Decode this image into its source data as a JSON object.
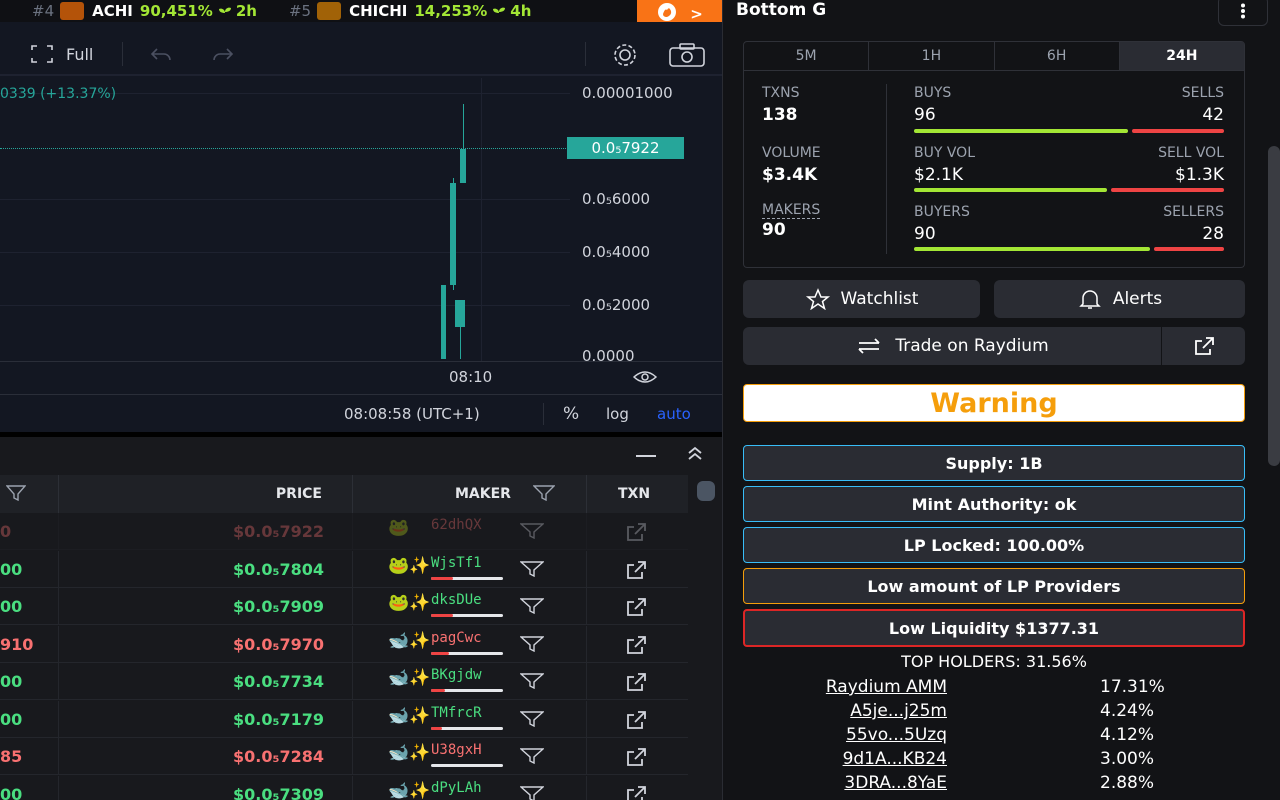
{
  "ticker": [
    {
      "rank": "#4",
      "symbol": "ACHI",
      "pct": "90,451%",
      "age": "2h",
      "avatar_color": "#b45309"
    },
    {
      "rank": "#5",
      "symbol": "CHICHI",
      "pct": "14,253%",
      "age": "4h",
      "avatar_color": "#a16207"
    }
  ],
  "chart": {
    "toolbar": {
      "full_label": "Full"
    },
    "change_label": "0339 (+13.37%)",
    "price_tag": "0.0₅7922",
    "y_ticks": [
      "0.00001000",
      "0.0₅6000",
      "0.0₅4000",
      "0.0₅2000",
      "0.0000"
    ],
    "x_tick": "08:10",
    "clock": "08:08:58 (UTC+1)",
    "percent_label": "%",
    "log_label": "log",
    "auto_label": "auto"
  },
  "chart_data": {
    "type": "candlestick",
    "x": [
      "08:05",
      "08:06",
      "08:07",
      "08:08"
    ],
    "open": [
      0.0,
      1.2e-06,
      2.8e-06,
      6.6e-06
    ],
    "high": [
      2.8e-06,
      2.2e-06,
      6.8e-06,
      9.6e-06
    ],
    "low": [
      0.0,
      0.0,
      2.6e-06,
      6.6e-06
    ],
    "close": [
      2.8e-06,
      2.2e-06,
      6.6e-06,
      7.9e-06
    ],
    "ylim": [
      0.0,
      1e-05
    ],
    "current_price": 7.9e-06
  },
  "trades": {
    "headers": {
      "price": "PRICE",
      "maker": "MAKER",
      "txn": "TXN"
    },
    "rows": [
      {
        "amount": "0",
        "price": "$0.0₅7922",
        "maker": "62dhQX",
        "type": "sell",
        "faded": true,
        "icon": "🐸",
        "bar": 0
      },
      {
        "amount": "00",
        "price": "$0.0₅7804",
        "maker": "WjsTf1",
        "type": "buy",
        "icon": "🐸✨",
        "bar": 0.3
      },
      {
        "amount": "00",
        "price": "$0.0₅7909",
        "maker": "dksDUe",
        "type": "buy",
        "icon": "🐸✨",
        "bar": 0.3
      },
      {
        "amount": "910",
        "price": "$0.0₅7970",
        "maker": "pagCwc",
        "type": "sell",
        "icon": "🐋✨",
        "bar": 0.25
      },
      {
        "amount": "00",
        "price": "$0.0₅7734",
        "maker": "BKgjdw",
        "type": "buy",
        "icon": "🐋✨",
        "bar": 0.2
      },
      {
        "amount": "00",
        "price": "$0.0₅7179",
        "maker": "TMfrcR",
        "type": "buy",
        "icon": "🐋✨",
        "bar": 0.15
      },
      {
        "amount": "85",
        "price": "$0.0₅7284",
        "maker": "U38gxH",
        "type": "sell",
        "icon": "🐋✨",
        "bar": 0
      },
      {
        "amount": "00",
        "price": "$0.0₅7309",
        "maker": "dPyLAh",
        "type": "buy",
        "icon": "🐋✨",
        "bar": 0.1
      }
    ]
  },
  "right": {
    "token_name": "Bottom G",
    "timeframes": [
      "5M",
      "1H",
      "6H",
      "24H"
    ],
    "stats": {
      "txns_label": "TXNS",
      "txns": "138",
      "volume_label": "VOLUME",
      "volume": "$3.4K",
      "makers_label": "MAKERS",
      "makers": "90",
      "buys_label": "BUYS",
      "buys": "96",
      "sells_label": "SELLS",
      "sells": "42",
      "buy_vol_label": "BUY VOL",
      "buy_vol": "$2.1K",
      "sell_vol_label": "SELL VOL",
      "sell_vol": "$1.3K",
      "buyers_label": "BUYERS",
      "buyers": "90",
      "sellers_label": "SELLERS",
      "sellers": "28"
    },
    "watchlist_label": "Watchlist",
    "alerts_label": "Alerts",
    "trade_label": "Trade on Raydium",
    "warning_label": "Warning",
    "checks": [
      {
        "label": "Supply: 1B",
        "level": "ok"
      },
      {
        "label": "Mint Authority: ok",
        "level": "ok"
      },
      {
        "label": "LP Locked: 100.00%",
        "level": "ok"
      },
      {
        "label": "Low amount of LP Providers",
        "level": "warn"
      },
      {
        "label": "Low Liquidity $1377.31",
        "level": "danger"
      }
    ],
    "top_holders_label": "TOP HOLDERS: 31.56%",
    "holders": [
      {
        "name": "Raydium AMM",
        "pct": "17.31%"
      },
      {
        "name": "A5je...j25m",
        "pct": "4.24%"
      },
      {
        "name": "55vo...5Uzq",
        "pct": "4.12%"
      },
      {
        "name": "9d1A...KB24",
        "pct": "3.00%"
      },
      {
        "name": "3DRA...8YaE",
        "pct": "2.88%"
      }
    ]
  },
  "colors": {
    "accent_green": "#26a69a",
    "buy_green": "#4ade80",
    "sell_red": "#f87171",
    "warning_orange": "#f59e0b",
    "brand_orange": "#f97316"
  }
}
